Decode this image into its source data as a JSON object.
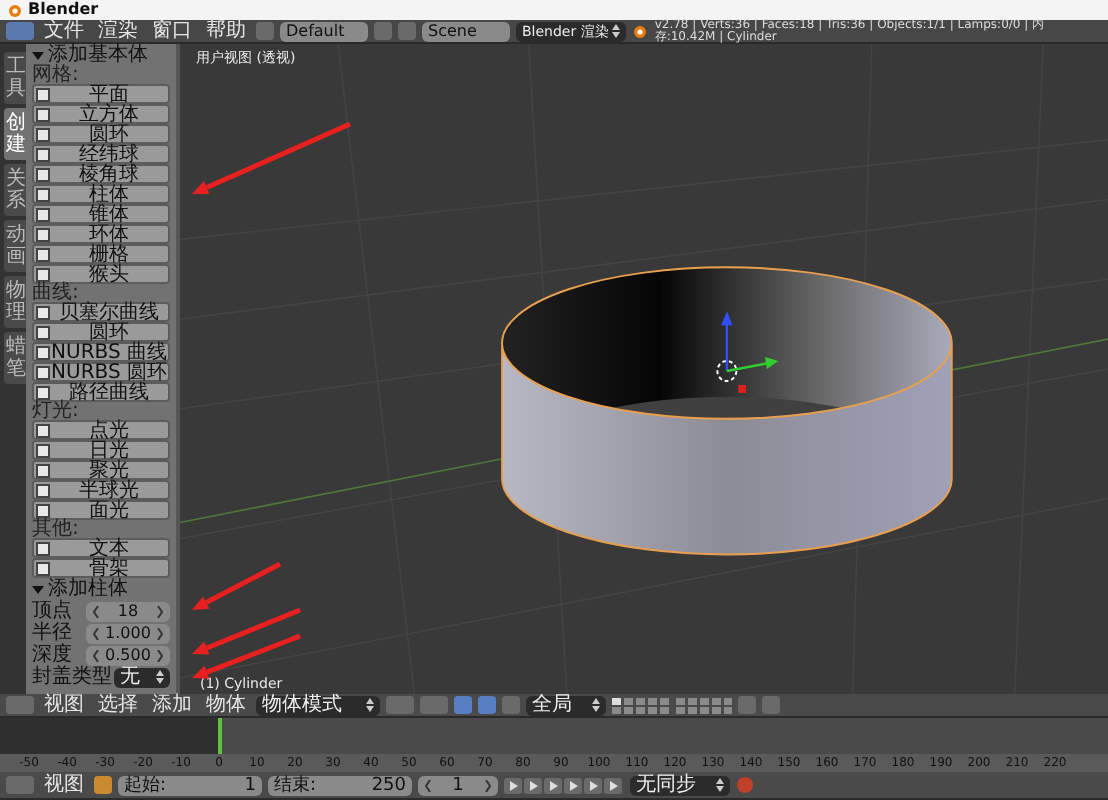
{
  "window": {
    "title": "Blender"
  },
  "top_bar": {
    "menus": [
      "文件",
      "渲染",
      "窗口",
      "帮助"
    ],
    "layout": "Default",
    "scene": "Scene",
    "render_engine": "Blender 渲染",
    "stats": "v2.78 | Verts:36 | Faces:18 | Tris:36 | Objects:1/1 | Lamps:0/0 | 内存:10.42M | Cylinder"
  },
  "tool_tabs": [
    {
      "label": "工具",
      "selected": false
    },
    {
      "label": "创建",
      "selected": true
    },
    {
      "label": "关系",
      "selected": false
    },
    {
      "label": "动画",
      "selected": false
    },
    {
      "label": "物理",
      "selected": false
    },
    {
      "label": "蜡笔",
      "selected": false
    }
  ],
  "add_panel": {
    "title": "添加基本体",
    "expanded": true,
    "sections": [
      {
        "heading": "网格:",
        "buttons": [
          "平面",
          "立方体",
          "圆环",
          "经纬球",
          "棱角球",
          "柱体",
          "锥体",
          "环体",
          "栅格",
          "猴头"
        ]
      },
      {
        "heading": "曲线:",
        "buttons": [
          "贝塞尔曲线",
          "圆环",
          "NURBS 曲线",
          "NURBS 圆环",
          "路径曲线"
        ]
      },
      {
        "heading": "灯光:",
        "buttons": [
          "点光",
          "日光",
          "聚光",
          "半球光",
          "面光"
        ]
      },
      {
        "heading": "其他:",
        "buttons": [
          "文本",
          "骨架"
        ]
      }
    ]
  },
  "operator_panel": {
    "title": "添加柱体",
    "expanded": true,
    "fields": [
      {
        "label": "顶点",
        "value": "18",
        "kind": "number"
      },
      {
        "label": "半径",
        "value": "1.000",
        "kind": "number"
      },
      {
        "label": "深度",
        "value": "0.500",
        "kind": "number"
      },
      {
        "label": "封盖类型",
        "value": "无",
        "kind": "dropdown"
      }
    ]
  },
  "viewport": {
    "label": "用户视图 (透视)",
    "object_label": "(1) Cylinder"
  },
  "viewport_header": {
    "menus": [
      "视图",
      "选择",
      "添加",
      "物体"
    ],
    "mode": "物体模式",
    "orientation": "全局"
  },
  "timeline": {
    "ruler": [
      "-50",
      "-40",
      "-30",
      "-20",
      "-10",
      "0",
      "10",
      "20",
      "30",
      "40",
      "50",
      "60",
      "70",
      "80",
      "90",
      "100",
      "110",
      "120",
      "130",
      "140",
      "150",
      "160",
      "170",
      "180",
      "190",
      "200",
      "210",
      "220"
    ],
    "menus": [
      "视图"
    ],
    "start_label": "起始:",
    "start": "1",
    "end_label": "结束:",
    "end": "250",
    "current": "1",
    "sync": "无同步"
  }
}
